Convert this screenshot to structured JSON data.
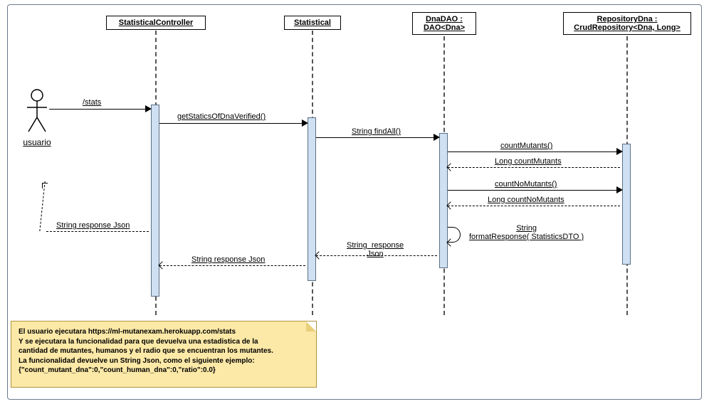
{
  "participants": {
    "actor": "usuario",
    "p1": "StatisticalController",
    "p2": "Statistical",
    "p3": "DnaDAO :\nDAO<Dna>",
    "p4": "RepositoryDna :\nCrudRepository<Dna, Long>"
  },
  "messages": {
    "m1": "/stats",
    "m2": "getStaticsOfDnaVerified()",
    "m3": "String findAll()",
    "m4": "countMutants()",
    "m5": "Long  countMutants",
    "m6": "countNoMutants()",
    "m7": "Long  countNoMutants",
    "m8": "String\nformatResponse( StatisticsDTO )",
    "m9": "String  response\nJson",
    "m10": "String   response Json",
    "m11": "String   response Json"
  },
  "note": {
    "l1": "El usuario ejecutara https://ml-mutanexam.herokuapp.com/stats",
    "l2": "Y se ejecutara la funcionalidad para que devuelva una estadistica de la",
    "l3": "cantidad de mutantes, humanos y el radio que se encuentran los mutantes.",
    "l4": "La funcionalidad devuelve un String Json, como el siguiente ejemplo:",
    "l5": "{\"count_mutant_dna\":0,\"count_human_dna\":0,\"ratio\":0.0}"
  }
}
